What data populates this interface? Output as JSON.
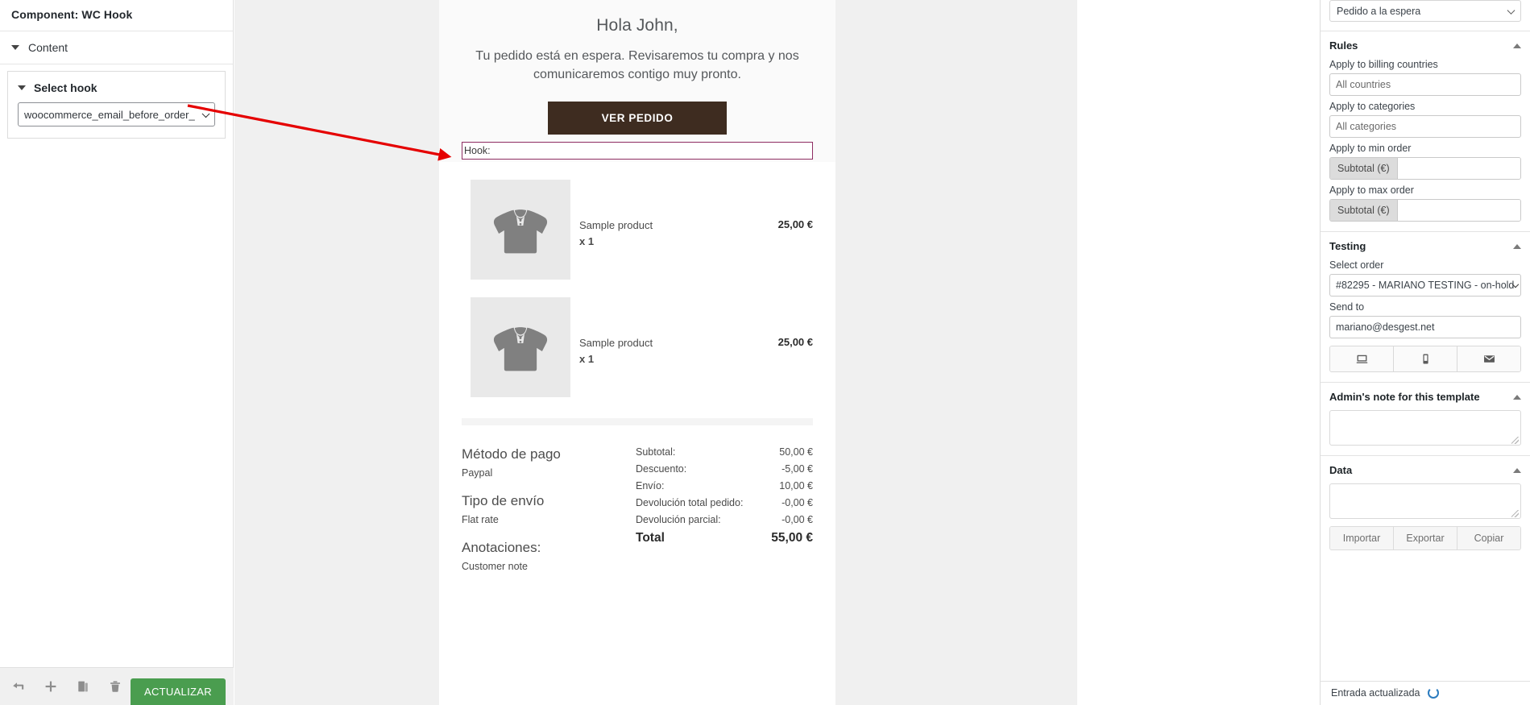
{
  "left_panel": {
    "component_title": "Component: WC Hook",
    "content_accordion": "Content",
    "select_hook_accordion": "Select hook",
    "hook_select_value": "woocommerce_email_before_order_",
    "toolbar": {
      "back_icon": "back-arrow-icon",
      "add_icon": "plus-icon",
      "duplicate_icon": "copy-icon",
      "delete_icon": "trash-icon",
      "update_label": "ACTUALIZAR"
    }
  },
  "email": {
    "greeting": "Hola John,",
    "subtitle": "Tu pedido está en espera. Revisaremos tu compra y nos comunicaremos contigo muy pronto.",
    "cta_label": "VER PEDIDO",
    "hook_placeholder_label": "Hook:",
    "products": [
      {
        "name": "Sample product",
        "qty": "x 1",
        "price": "25,00 €"
      },
      {
        "name": "Sample product",
        "qty": "x 1",
        "price": "25,00 €"
      }
    ],
    "left_meta": [
      {
        "heading": "Método de pago",
        "value": "Paypal"
      },
      {
        "heading": "Tipo de envío",
        "value": "Flat rate"
      },
      {
        "heading": "Anotaciones:",
        "value": "Customer note"
      }
    ],
    "totals": [
      {
        "label": "Subtotal:",
        "value": "50,00 €"
      },
      {
        "label": "Descuento:",
        "value": "-5,00 €"
      },
      {
        "label": "Envío:",
        "value": "10,00 €"
      },
      {
        "label": "Devolución total pedido:",
        "value": "-0,00 €"
      },
      {
        "label": "Devolución parcial:",
        "value": "-0,00 €"
      }
    ],
    "grand_total": {
      "label": "Total",
      "value": "55,00 €"
    }
  },
  "right_panel": {
    "status_select_value": "Pedido a la espera",
    "rules": {
      "heading": "Rules",
      "billing_countries_label": "Apply to billing countries",
      "billing_countries_value": "All countries",
      "categories_label": "Apply to categories",
      "categories_value": "All categories",
      "min_order_label": "Apply to min order",
      "min_order_prefix": "Subtotal (€)",
      "min_order_value": "",
      "max_order_label": "Apply to max order",
      "max_order_prefix": "Subtotal (€)",
      "max_order_value": ""
    },
    "testing": {
      "heading": "Testing",
      "select_order_label": "Select order",
      "select_order_value": "#82295 - MARIANO TESTING - on-hold",
      "send_to_label": "Send to",
      "send_to_value": "mariano@desgest.net",
      "preview_desktop_icon": "desktop-preview-icon",
      "preview_mobile_icon": "mobile-preview-icon",
      "send_email_icon": "envelope-icon"
    },
    "admin_note": {
      "heading": "Admin's note for this template",
      "value": ""
    },
    "data": {
      "heading": "Data",
      "value": "",
      "import_label": "Importar",
      "export_label": "Exportar",
      "copy_label": "Copiar"
    },
    "toast": {
      "message": "Entrada actualizada",
      "icon": "spinner-icon"
    }
  },
  "annotation": {
    "arrow_color": "#e50000"
  },
  "colors": {
    "cta_button": "#3e2c20",
    "hook_border": "#8e2c62",
    "update_button": "#4a9d4f",
    "canvas": "#f0f0f0"
  }
}
